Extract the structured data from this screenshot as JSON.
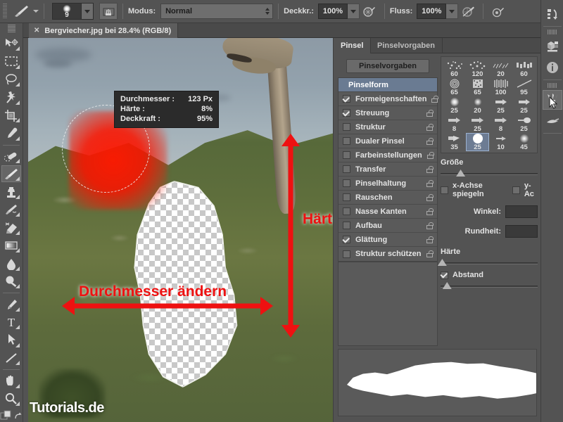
{
  "app": {
    "name": "Adobe Photoshop"
  },
  "options_bar": {
    "tool_icon": "brush-tool-icon",
    "brush_size_value": "9",
    "brush_preset_picker_icon": "brush-preset-picker-icon",
    "airbrush_icon": "airbrush-icon",
    "mode_label": "Modus:",
    "mode_value": "Normal",
    "opacity_label": "Deckkr.:",
    "opacity_value": "100%",
    "opacity_pressure_icon": "tablet-pressure-opacity-icon",
    "flow_label": "Fluss:",
    "flow_value": "100%",
    "flow_pressure_icon": "tablet-pressure-flow-icon",
    "airbrush_toggle_icon": "airbrush-toggle-icon"
  },
  "toolbar": {
    "tools": [
      {
        "name": "move-tool",
        "icon": "move-arrow-icon",
        "active": false
      },
      {
        "name": "rectangular-marquee-tool",
        "icon": "marquee-rect-icon",
        "active": false
      },
      {
        "name": "lasso-tool",
        "icon": "lasso-icon",
        "active": false
      },
      {
        "name": "magic-wand-tool",
        "icon": "magic-wand-icon",
        "active": false
      },
      {
        "name": "crop-tool",
        "icon": "crop-icon",
        "active": false
      },
      {
        "name": "eyedropper-tool",
        "icon": "eyedropper-icon",
        "active": false
      },
      {
        "name": "healing-brush-tool",
        "icon": "healing-brush-icon",
        "active": false
      },
      {
        "name": "brush-tool",
        "icon": "brush-icon",
        "active": true
      },
      {
        "name": "clone-stamp-tool",
        "icon": "clone-stamp-icon",
        "active": false
      },
      {
        "name": "history-brush-tool",
        "icon": "history-brush-icon",
        "active": false
      },
      {
        "name": "eraser-tool",
        "icon": "eraser-icon",
        "active": false
      },
      {
        "name": "gradient-tool",
        "icon": "gradient-icon",
        "active": false
      },
      {
        "name": "blur-tool",
        "icon": "blur-drop-icon",
        "active": false
      },
      {
        "name": "dodge-tool",
        "icon": "dodge-icon",
        "active": false
      },
      {
        "name": "pen-tool",
        "icon": "pen-icon",
        "active": false
      },
      {
        "name": "type-tool",
        "icon": "type-T-icon",
        "active": false
      },
      {
        "name": "path-selection-tool",
        "icon": "path-arrow-icon",
        "active": false
      },
      {
        "name": "line-shape-tool",
        "icon": "line-shape-icon",
        "active": false
      },
      {
        "name": "hand-tool",
        "icon": "hand-icon",
        "active": false
      },
      {
        "name": "zoom-tool",
        "icon": "zoom-magnifier-icon",
        "active": false
      }
    ],
    "color_swatches_icon": "foreground-background-color-icon",
    "swap_colors_icon": "swap-colors-icon"
  },
  "document": {
    "tab_title": "Bergviecher.jpg bei 28.4% (RGB/8)",
    "close_icon": "close-tab-icon",
    "zoom_level": "28.4%",
    "color_mode": "RGB/8",
    "watermark": "Tutorials.de"
  },
  "brush_tooltip": {
    "rows": [
      {
        "label": "Durchmesser :",
        "value": "123 Px"
      },
      {
        "label": "Härte :",
        "value": "8%"
      },
      {
        "label": "Deckkraft :",
        "value": "95%"
      }
    ]
  },
  "annotations": [
    {
      "name": "annotation-diameter",
      "text": "Durchmesser ändern",
      "arrow": "double-horizontal-arrow"
    },
    {
      "name": "annotation-hardness",
      "text": "Härte ändern",
      "arrow": "double-vertical-arrow"
    },
    {
      "name": "annotation-size-pointer",
      "text": "",
      "arrow": "up-arrow-to-size-slider"
    }
  ],
  "brush_panel": {
    "tabs": [
      {
        "label": "Pinsel",
        "active": true
      },
      {
        "label": "Pinselvorgaben",
        "active": false
      }
    ],
    "preset_button": "Pinselvorgaben",
    "options": [
      {
        "label": "Pinselform",
        "checked": null,
        "header": true,
        "locked": false
      },
      {
        "label": "Formeigenschaften",
        "checked": true,
        "locked": true
      },
      {
        "label": "Streuung",
        "checked": true,
        "locked": true
      },
      {
        "label": "Struktur",
        "checked": false,
        "locked": true
      },
      {
        "label": "Dualer Pinsel",
        "checked": false,
        "locked": true
      },
      {
        "label": "Farbeinstellungen",
        "checked": false,
        "locked": true
      },
      {
        "label": "Transfer",
        "checked": false,
        "locked": true
      },
      {
        "label": "Pinselhaltung",
        "checked": false,
        "locked": true
      },
      {
        "label": "Rauschen",
        "checked": false,
        "locked": true
      },
      {
        "label": "Nasse Kanten",
        "checked": false,
        "locked": true
      },
      {
        "label": "Aufbau",
        "checked": false,
        "locked": true
      },
      {
        "label": "Glättung",
        "checked": true,
        "locked": true
      },
      {
        "label": "Struktur schützen",
        "checked": false,
        "locked": true
      }
    ],
    "presets": [
      {
        "num": "60",
        "thumb": "speckle-brush-icon",
        "selected": false
      },
      {
        "num": "120",
        "thumb": "speckle-brush-icon",
        "selected": false
      },
      {
        "num": "20",
        "thumb": "texture-brush-icon",
        "selected": false
      },
      {
        "num": "60",
        "thumb": "texture-brush-icon",
        "selected": false
      },
      {
        "num": "65",
        "thumb": "spiral-brush-icon",
        "selected": false
      },
      {
        "num": "65",
        "thumb": "noise-square-brush-icon",
        "selected": false
      },
      {
        "num": "100",
        "thumb": "bristle-brush-icon",
        "selected": false
      },
      {
        "num": "95",
        "thumb": "diagonal-brush-icon",
        "selected": false
      },
      {
        "num": "25",
        "thumb": "soft-round-brush-icon",
        "selected": false
      },
      {
        "num": "20",
        "thumb": "soft-round-brush-icon",
        "selected": false
      },
      {
        "num": "25",
        "thumb": "flat-tip-brush-icon",
        "selected": false
      },
      {
        "num": "25",
        "thumb": "flat-tip-brush-icon",
        "selected": false
      },
      {
        "num": "8",
        "thumb": "flat-tip-brush-icon",
        "selected": false
      },
      {
        "num": "25",
        "thumb": "flat-tip-brush-icon",
        "selected": false
      },
      {
        "num": "8",
        "thumb": "flat-tip-brush-icon",
        "selected": false
      },
      {
        "num": "25",
        "thumb": "round-fan-brush-icon",
        "selected": false
      },
      {
        "num": "35",
        "thumb": "flat-angle-brush-icon",
        "selected": false
      },
      {
        "num": "25",
        "thumb": "hard-round-brush-icon",
        "selected": true
      },
      {
        "num": "10",
        "thumb": "flat-tip-brush-icon",
        "selected": false
      },
      {
        "num": "45",
        "thumb": "soft-round-brush-icon",
        "selected": false
      }
    ],
    "size_label": "Größe",
    "flip_x_label": "x-Achse spiegeln",
    "flip_y_label": "y-Ac",
    "angle_label": "Winkel:",
    "roundness_label": "Rundheit:",
    "hardness_label": "Härte",
    "spacing_label": "Abstand",
    "spacing_checked": true,
    "flip_x_checked": false,
    "flip_y_checked": false
  },
  "right_dock": {
    "items": [
      {
        "name": "history-panel-icon",
        "active": false
      },
      {
        "name": "mini-bridge-panel-icon",
        "active": false
      },
      {
        "name": "info-panel-icon",
        "active": false
      },
      {
        "name": "brush-panel-icon",
        "active": true
      },
      {
        "name": "brush-presets-panel-icon",
        "active": false
      }
    ]
  },
  "colors": {
    "chrome": "#535353",
    "accent_red": "#ee1111",
    "selection_blue": "#6a7b92",
    "panel_dark": "#3a3a3a"
  }
}
